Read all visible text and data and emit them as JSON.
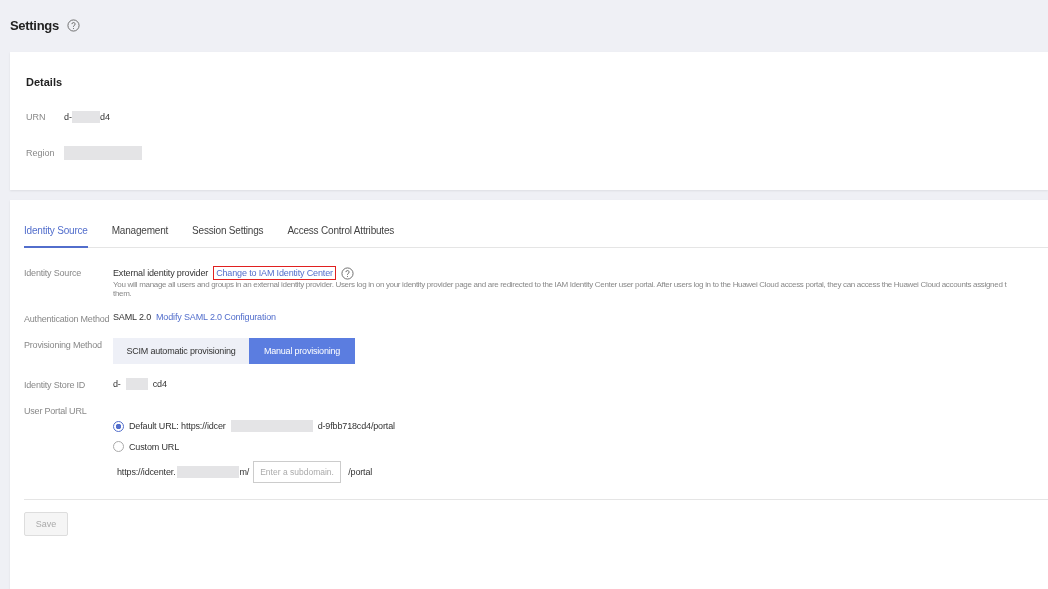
{
  "page": {
    "title": "Settings"
  },
  "details": {
    "title": "Details",
    "fields": [
      {
        "label": "URN",
        "value_start": "d-",
        "value_end": "d4"
      },
      {
        "label": "Region"
      }
    ]
  },
  "tabs": [
    {
      "label": "Identity Source",
      "selected": true
    },
    {
      "label": "Management",
      "selected": false
    },
    {
      "label": "Session Settings",
      "selected": false
    },
    {
      "label": "Access Control Attributes",
      "selected": false
    }
  ],
  "identity_source": {
    "label": "Identity Source",
    "value": "External identity provider",
    "link": "Change to IAM Identity Center",
    "description_lines": [
      "You will manage all users and groups in an external identity provider. Users log in on your identity provider page and are redirected to the IAM Identity Center user portal. After users log in to the Huawei Cloud access portal, they can access the Huawei Cloud accounts assigned t",
      "them."
    ]
  },
  "authentication": {
    "label": "Authentication Method",
    "value": "SAML 2.0",
    "link": "Modify SAML 2.0 Configuration"
  },
  "provisioning": {
    "label": "Provisioning Method",
    "options": [
      {
        "label": "SCIM automatic provisioning",
        "selected": false
      },
      {
        "label": "Manual provisioning",
        "selected": true
      }
    ]
  },
  "identity_store": {
    "label": "Identity Store ID",
    "value_start": "d-",
    "value_end": "cd4"
  },
  "portal": {
    "label": "User Portal URL",
    "options": [
      {
        "kind": "default",
        "label": "Default URL: https://idcer",
        "label_end": "d-9fbb718cd4/portal",
        "selected": true
      },
      {
        "kind": "custom",
        "label": "Custom URL",
        "selected": false
      }
    ],
    "custom": {
      "prefix": "https://idcenter.",
      "prefix_end": "m/",
      "placeholder": "Enter a subdomain.",
      "suffix": "/portal"
    }
  },
  "save": {
    "label": "Save",
    "disabled": true
  }
}
